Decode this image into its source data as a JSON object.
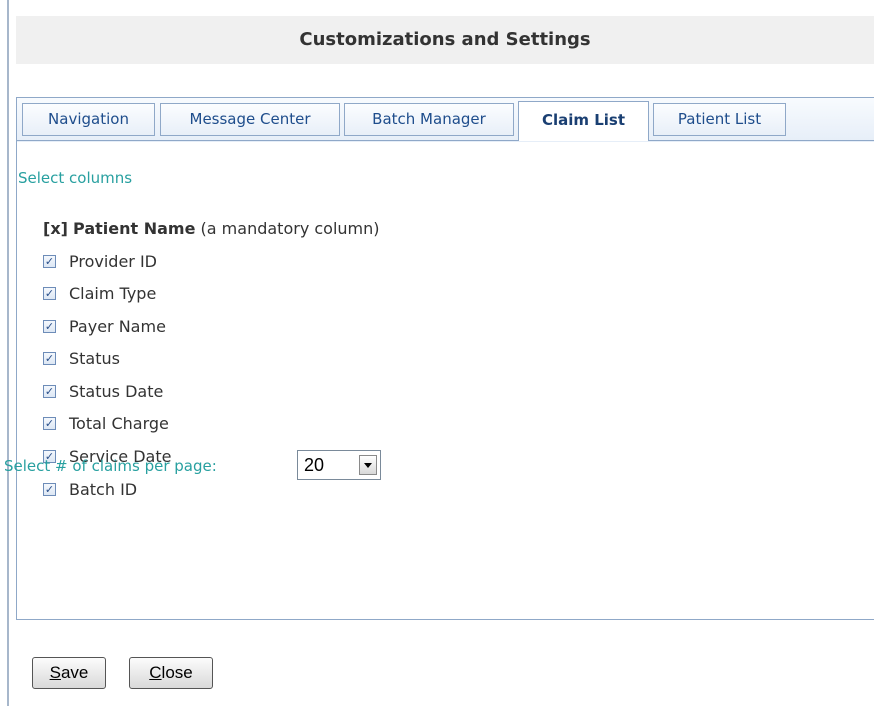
{
  "dialog": {
    "title": "Customizations and Settings"
  },
  "tabs": [
    {
      "label": "Navigation",
      "active": false
    },
    {
      "label": "Message Center",
      "active": false
    },
    {
      "label": "Batch Manager",
      "active": false
    },
    {
      "label": "Claim List",
      "active": true
    },
    {
      "label": "Patient List",
      "active": false
    }
  ],
  "columns_section": {
    "label": "Select columns",
    "mandatory": {
      "marker": "[x]",
      "name": "Patient Name",
      "note": "(a mandatory column)"
    },
    "items": [
      {
        "label": "Provider ID",
        "checked": true
      },
      {
        "label": "Claim Type",
        "checked": true
      },
      {
        "label": "Payer Name",
        "checked": true
      },
      {
        "label": "Status",
        "checked": true
      },
      {
        "label": "Status Date",
        "checked": true
      },
      {
        "label": "Total Charge",
        "checked": true
      },
      {
        "label": "Service Date",
        "checked": true
      },
      {
        "label": "Batch ID",
        "checked": true
      }
    ]
  },
  "per_page": {
    "label": "Select # of claims per page:",
    "value": "20"
  },
  "buttons": {
    "save": {
      "mnemonic": "S",
      "rest": "ave"
    },
    "close": {
      "mnemonic": "C",
      "rest": "lose"
    }
  },
  "colors": {
    "accent_teal": "#28a0a0",
    "tab_text": "#1e4d8c",
    "border": "#8fa8c8"
  },
  "check_glyph": "✓"
}
